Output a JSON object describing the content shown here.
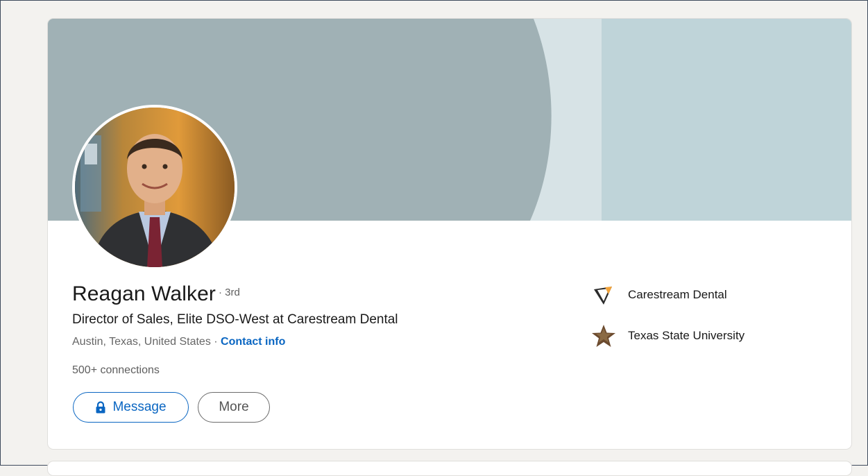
{
  "profile": {
    "name": "Reagan Walker",
    "degree": "· 3rd",
    "headline": "Director of Sales, Elite DSO-West at Carestream Dental",
    "location": "Austin, Texas, United States",
    "separator": " · ",
    "contact_label": "Contact info",
    "connections": "500+ connections"
  },
  "actions": {
    "message_label": "Message",
    "more_label": "More"
  },
  "side": {
    "company": {
      "label": "Carestream Dental",
      "icon": "carestream-logo-icon"
    },
    "school": {
      "label": "Texas State University",
      "icon": "texas-state-star-icon"
    }
  },
  "colors": {
    "accent": "#0a66c2",
    "cover_left": "#a0b1b5",
    "cover_band": "#d7e3e6",
    "cover_right": "#bfd4d9"
  }
}
